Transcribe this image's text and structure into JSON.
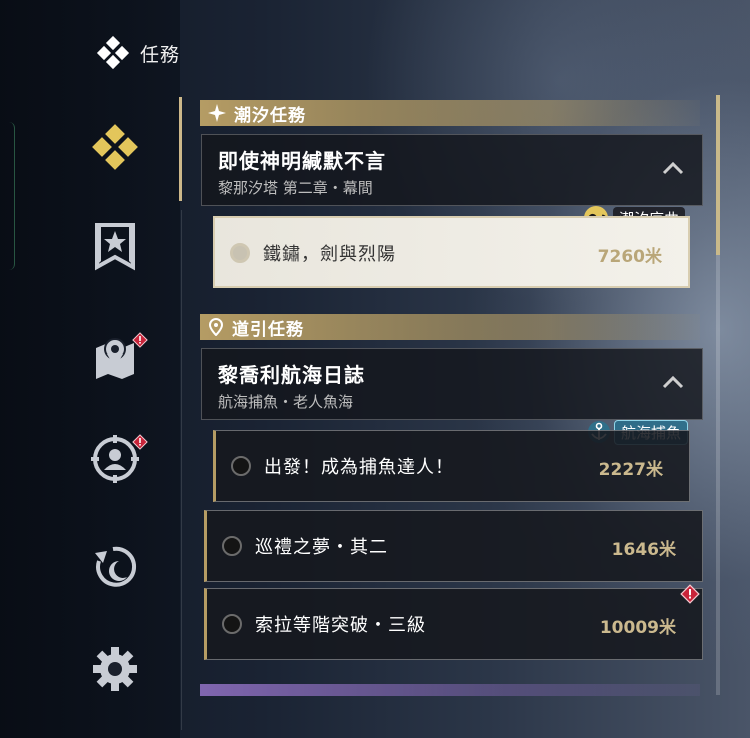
{
  "header": {
    "title": "任務",
    "icon": "quest-diamond-icon"
  },
  "sidebar": {
    "items": [
      {
        "name": "quests",
        "icon": "diamond-icon",
        "active": true,
        "alert": false
      },
      {
        "name": "banner",
        "icon": "banner-star-icon",
        "active": false,
        "alert": false
      },
      {
        "name": "map",
        "icon": "map-pin-icon",
        "active": false,
        "alert": true
      },
      {
        "name": "profile",
        "icon": "user-target-icon",
        "active": false,
        "alert": true
      },
      {
        "name": "moon",
        "icon": "moon-refresh-icon",
        "active": false,
        "alert": false
      },
      {
        "name": "settings",
        "icon": "gear-icon",
        "active": false,
        "alert": false
      }
    ]
  },
  "categories": [
    {
      "title": "潮汐任務",
      "icon": "sparkle-icon",
      "group": {
        "title": "即使神明緘默不言",
        "subtitle": "黎那汐塔 第二章・幕間",
        "tag": "潮汐序曲",
        "tasks": [
          {
            "label": "鐵鏽，劍與烈陽",
            "distance": "7260米",
            "selected": true
          }
        ]
      }
    },
    {
      "title": "道引任務",
      "icon": "location-pin-icon",
      "group": {
        "title": "黎喬利航海日誌",
        "subtitle": "航海捕魚・老人魚海",
        "tag": "航海捕魚",
        "tasks": [
          {
            "label": "出發！成為捕魚達人！",
            "distance": "2227米",
            "selected": false
          },
          {
            "label": "巡禮之夢・其二",
            "distance": "1646米",
            "selected": false
          },
          {
            "label": "索拉等階突破・三級",
            "distance": "10009米",
            "selected": false
          }
        ]
      }
    }
  ],
  "colors": {
    "gold": "#b59c64",
    "alert": "#c8243a",
    "distance": "#cbb98e"
  }
}
